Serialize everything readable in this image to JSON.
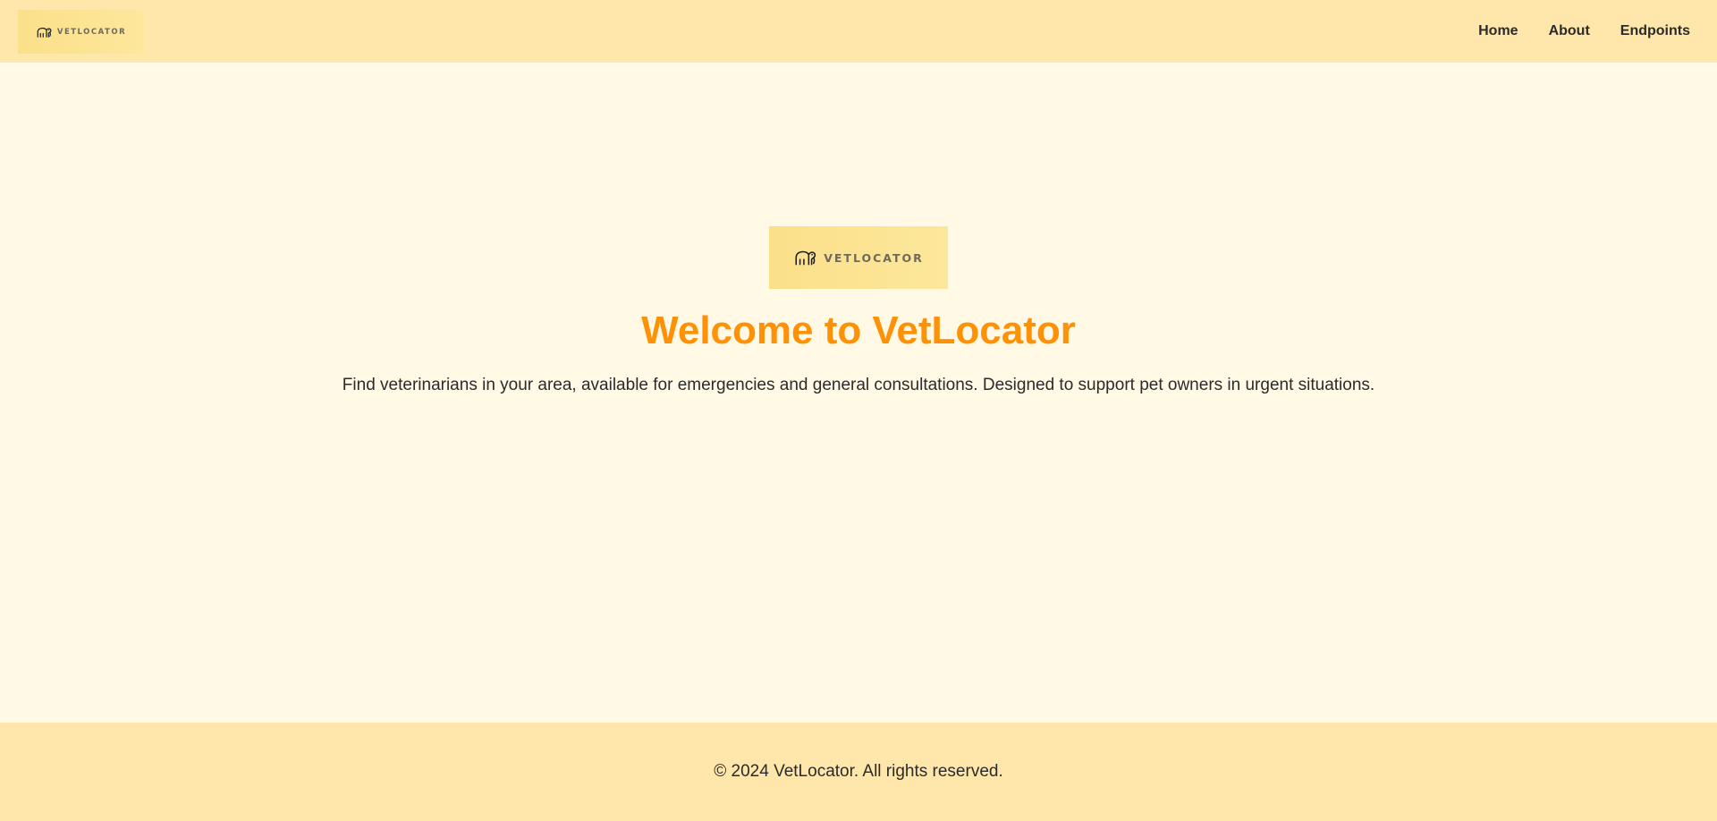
{
  "header": {
    "logo_text": "VETLOCATOR",
    "logo_icon": "elephant-icon",
    "nav": {
      "home": "Home",
      "about": "About",
      "endpoints": "Endpoints"
    }
  },
  "hero": {
    "logo_text": "VETLOCATOR",
    "logo_icon": "elephant-icon",
    "title": "Welcome to VetLocator",
    "subtitle": "Find veterinarians in your area, available for emergencies and general consultations. Designed to support pet owners in urgent situations."
  },
  "footer": {
    "copyright": "© 2024 VetLocator. All rights reserved."
  },
  "colors": {
    "header_bg": "#ffe6aa",
    "page_bg": "#fff9e6",
    "accent": "#ff9106",
    "text": "#2b2b2b",
    "logo_bg": "#fbe08a"
  }
}
